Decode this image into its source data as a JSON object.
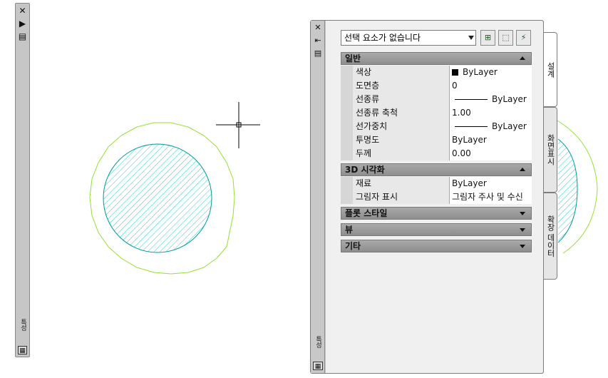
{
  "left_bar": {
    "vertical_label": "특성",
    "icons": [
      "close-icon",
      "autohide-icon",
      "properties-menu-icon",
      "palette-icon"
    ]
  },
  "palette": {
    "selection": "선택 요소가 없습니다",
    "toolbar_icons": [
      "toggle-pickadd-icon",
      "select-objects-icon",
      "quick-select-icon"
    ],
    "strip_label": "특성",
    "sections": {
      "general": {
        "title": "일반",
        "rows": [
          {
            "name": "색상",
            "value": "ByLayer"
          },
          {
            "name": "도면층",
            "value": "0"
          },
          {
            "name": "선종류",
            "value": "ByLayer"
          },
          {
            "name": "선종류 축척",
            "value": "1.00"
          },
          {
            "name": "선가중치",
            "value": "ByLayer"
          },
          {
            "name": "투명도",
            "value": "ByLayer"
          },
          {
            "name": "두께",
            "value": "0.00"
          }
        ]
      },
      "visual3d": {
        "title": "3D 시각화",
        "rows": [
          {
            "name": "재료",
            "value": "ByLayer"
          },
          {
            "name": "그림자 표시",
            "value": "그림자 주사 및 수신"
          }
        ]
      },
      "plot_style": {
        "title": "플롯 스타일"
      },
      "view": {
        "title": "뷰"
      },
      "misc": {
        "title": "기타"
      }
    },
    "tabs": [
      "설계",
      "화면표시",
      "확장 데이터"
    ]
  },
  "colors": {
    "hatch": "#33cccc",
    "outer_circle": "#99dd33",
    "inner_circle": "#009999"
  }
}
